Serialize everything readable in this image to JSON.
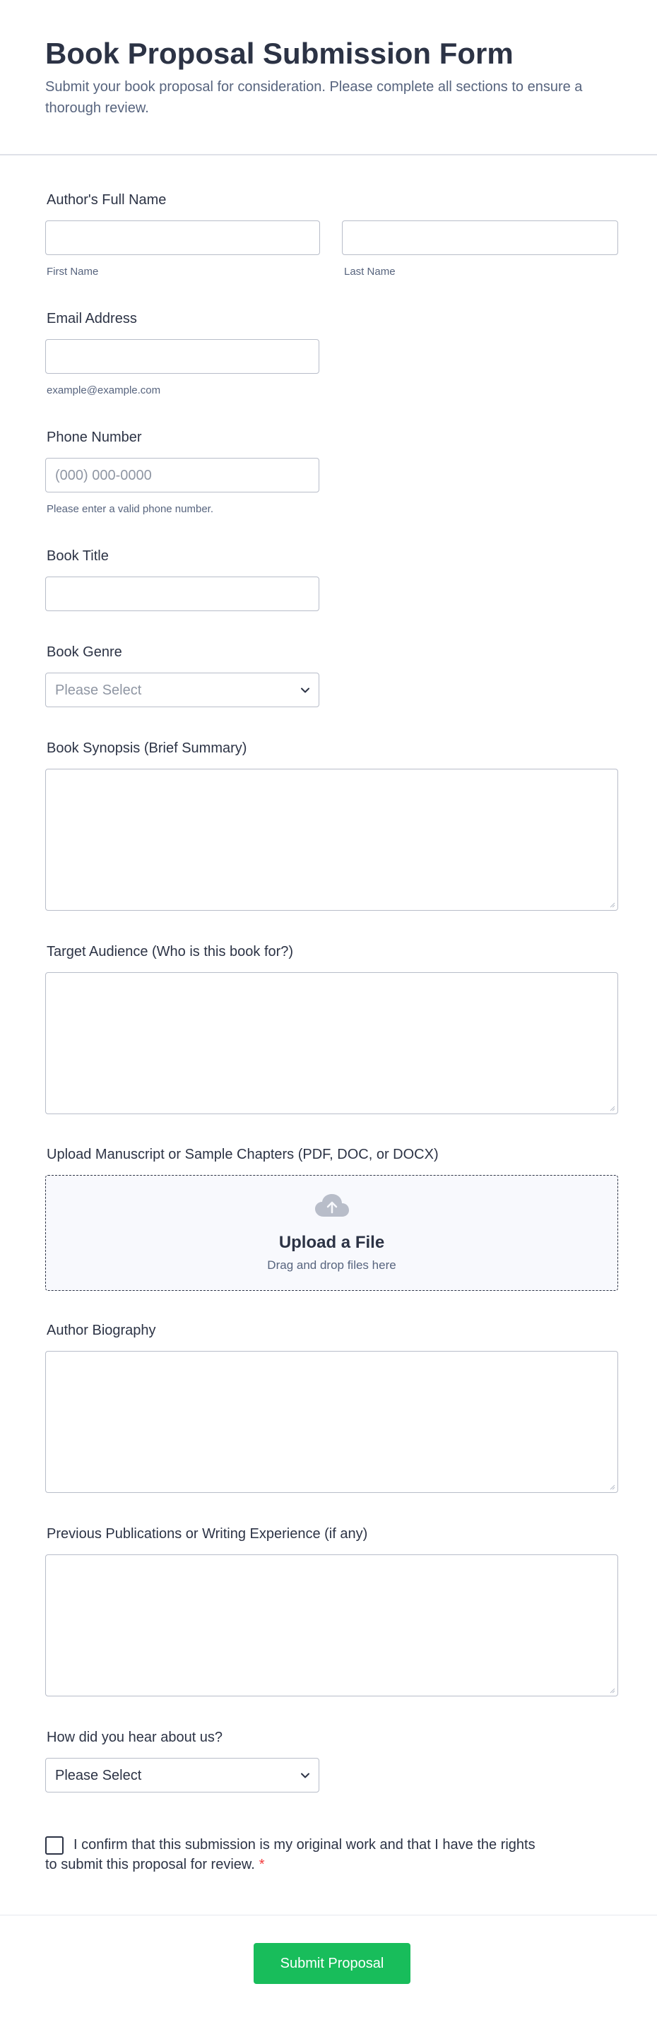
{
  "header": {
    "title": "Book Proposal Submission Form",
    "subtitle": "Submit your book proposal for consideration. Please complete all sections to ensure a thorough review."
  },
  "fields": {
    "author_name": {
      "label": "Author's Full Name",
      "first_sublabel": "First Name",
      "last_sublabel": "Last Name",
      "first_value": "",
      "last_value": ""
    },
    "email": {
      "label": "Email Address",
      "sublabel": "example@example.com",
      "value": ""
    },
    "phone": {
      "label": "Phone Number",
      "placeholder": "(000) 000-0000",
      "sublabel": "Please enter a valid phone number.",
      "value": ""
    },
    "book_title": {
      "label": "Book Title",
      "value": ""
    },
    "genre": {
      "label": "Book Genre",
      "selected": "Please Select"
    },
    "synopsis": {
      "label": "Book Synopsis (Brief Summary)",
      "value": ""
    },
    "audience": {
      "label": "Target Audience (Who is this book for?)",
      "value": ""
    },
    "upload": {
      "label": "Upload Manuscript or Sample Chapters (PDF, DOC, or DOCX)",
      "title": "Upload a File",
      "subtitle": "Drag and drop files here",
      "icon": "cloud-upload-icon"
    },
    "biography": {
      "label": "Author Biography",
      "value": ""
    },
    "publications": {
      "label": "Previous Publications or Writing Experience (if any)",
      "value": ""
    },
    "referral": {
      "label": "How did you hear about us?",
      "selected": "Please Select"
    },
    "confirm": {
      "text": "I confirm that this submission is my original work and that I have the rights to submit this proposal for review.",
      "required_mark": "*",
      "checked": false
    }
  },
  "submit_label": "Submit Proposal",
  "colors": {
    "accent": "#18bd5b",
    "text": "#2c3345",
    "muted": "#57647e",
    "border": "#b8bdc9",
    "required": "#f23a3c"
  }
}
